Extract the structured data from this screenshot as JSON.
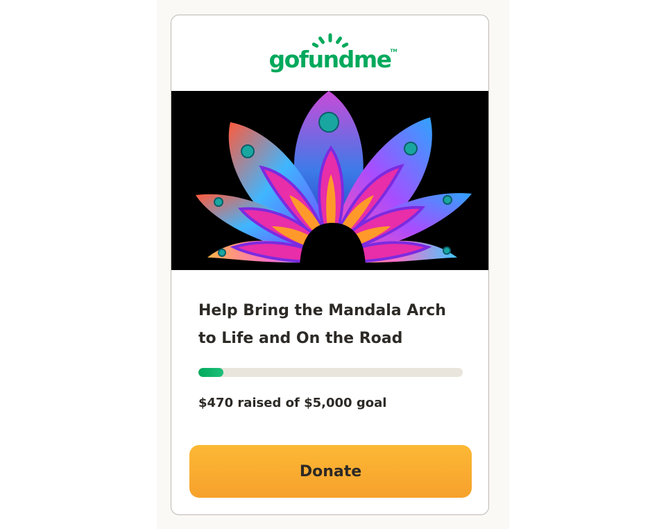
{
  "brand": {
    "name": "gofundme",
    "tm": "TM",
    "color": "#02a95c"
  },
  "campaign": {
    "image_alt": "Mandala Arch",
    "title": "Help Bring the Mandala Arch to Life and On the Road",
    "raised_text": "$470 raised of $5,000 goal",
    "raised_amount": 470,
    "goal_amount": 5000,
    "progress_fraction": 0.094
  },
  "actions": {
    "donate_label": "Donate",
    "donate_color": "#fdb835"
  }
}
